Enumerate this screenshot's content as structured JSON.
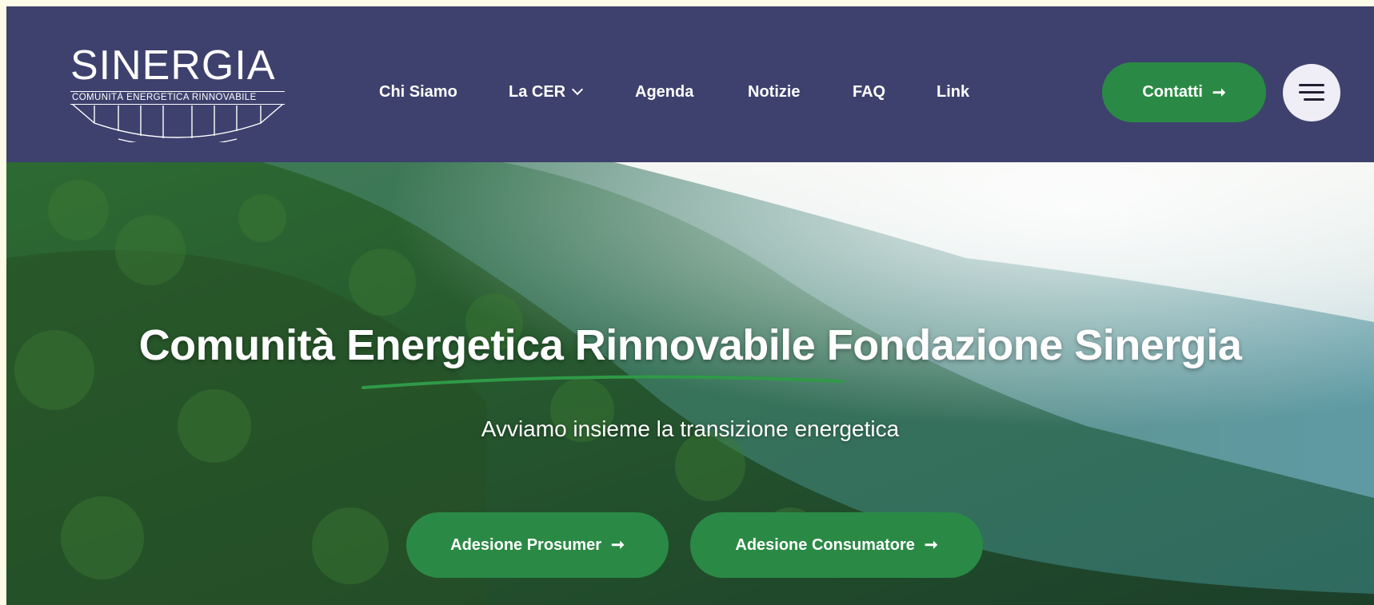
{
  "logo": {
    "wordmark": "SINERGIA",
    "tagline": "COMUNITÀ ENERGETICA RINNOVABILE"
  },
  "nav": {
    "items": [
      {
        "label": "Chi Siamo"
      },
      {
        "label": "La CER",
        "has_dropdown": true
      },
      {
        "label": "Agenda"
      },
      {
        "label": "Notizie"
      },
      {
        "label": "FAQ"
      },
      {
        "label": "Link"
      }
    ]
  },
  "header": {
    "contact_button": "Contatti",
    "arrow_icon": "arrow-right-icon",
    "menu_icon": "hamburger-menu-icon"
  },
  "hero": {
    "title": "Comunità Energetica Rinnovabile Fondazione Sinergia",
    "subtitle": "Avviamo insieme la transizione energetica",
    "buttons": [
      {
        "label": "Adesione Prosumer"
      },
      {
        "label": "Adesione Consumatore"
      }
    ]
  },
  "colors": {
    "header_bg": "#3e416d",
    "accent_green": "#2a8a45",
    "page_frame": "#fdfbe8"
  }
}
